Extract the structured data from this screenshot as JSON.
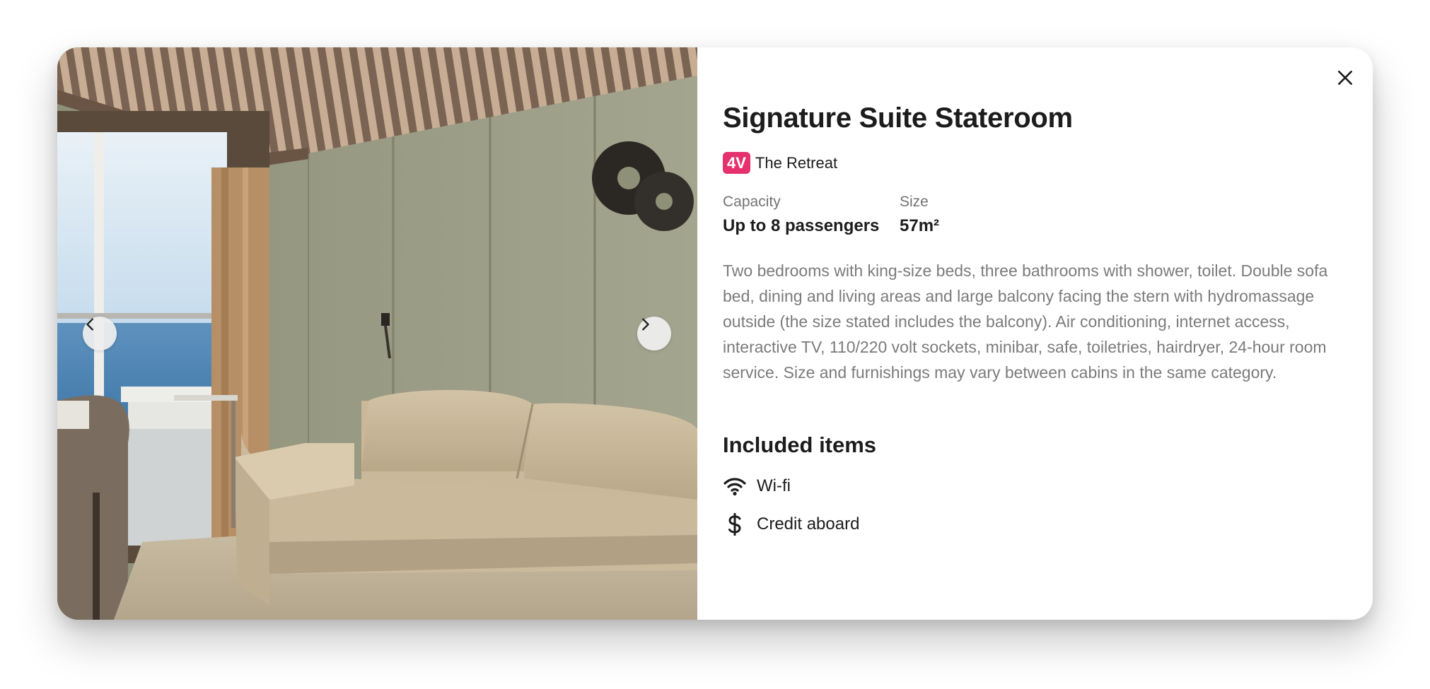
{
  "room": {
    "title": "Signature Suite Stateroom",
    "badge": "4V",
    "area": "The Retreat",
    "badge_color": "#e5326f"
  },
  "specs": [
    {
      "label": "Capacity",
      "value": "Up to 8 passengers"
    },
    {
      "label": "Size",
      "value": "57m²"
    }
  ],
  "description": "Two bedrooms with king-size beds, three bathrooms with shower, toilet. Double sofa bed, dining and living areas and large balcony facing the stern with hydromassage outside (the size stated includes the balcony). Air conditioning, internet access, interactive TV, 110/220 volt sockets, minibar, safe, toiletries, hairdryer, 24-hour room service. Size and furnishings may vary between cabins in the same category.",
  "included": {
    "title": "Included items",
    "items": [
      {
        "icon": "wifi-icon",
        "label": "Wi-fi"
      },
      {
        "icon": "dollar-icon",
        "label": "Credit aboard"
      }
    ]
  },
  "gallery": {
    "image_subject": "stateroom-interior-photo",
    "prev_icon": "chevron-left-icon",
    "next_icon": "chevron-right-icon"
  },
  "controls": {
    "close_icon": "close-icon"
  }
}
